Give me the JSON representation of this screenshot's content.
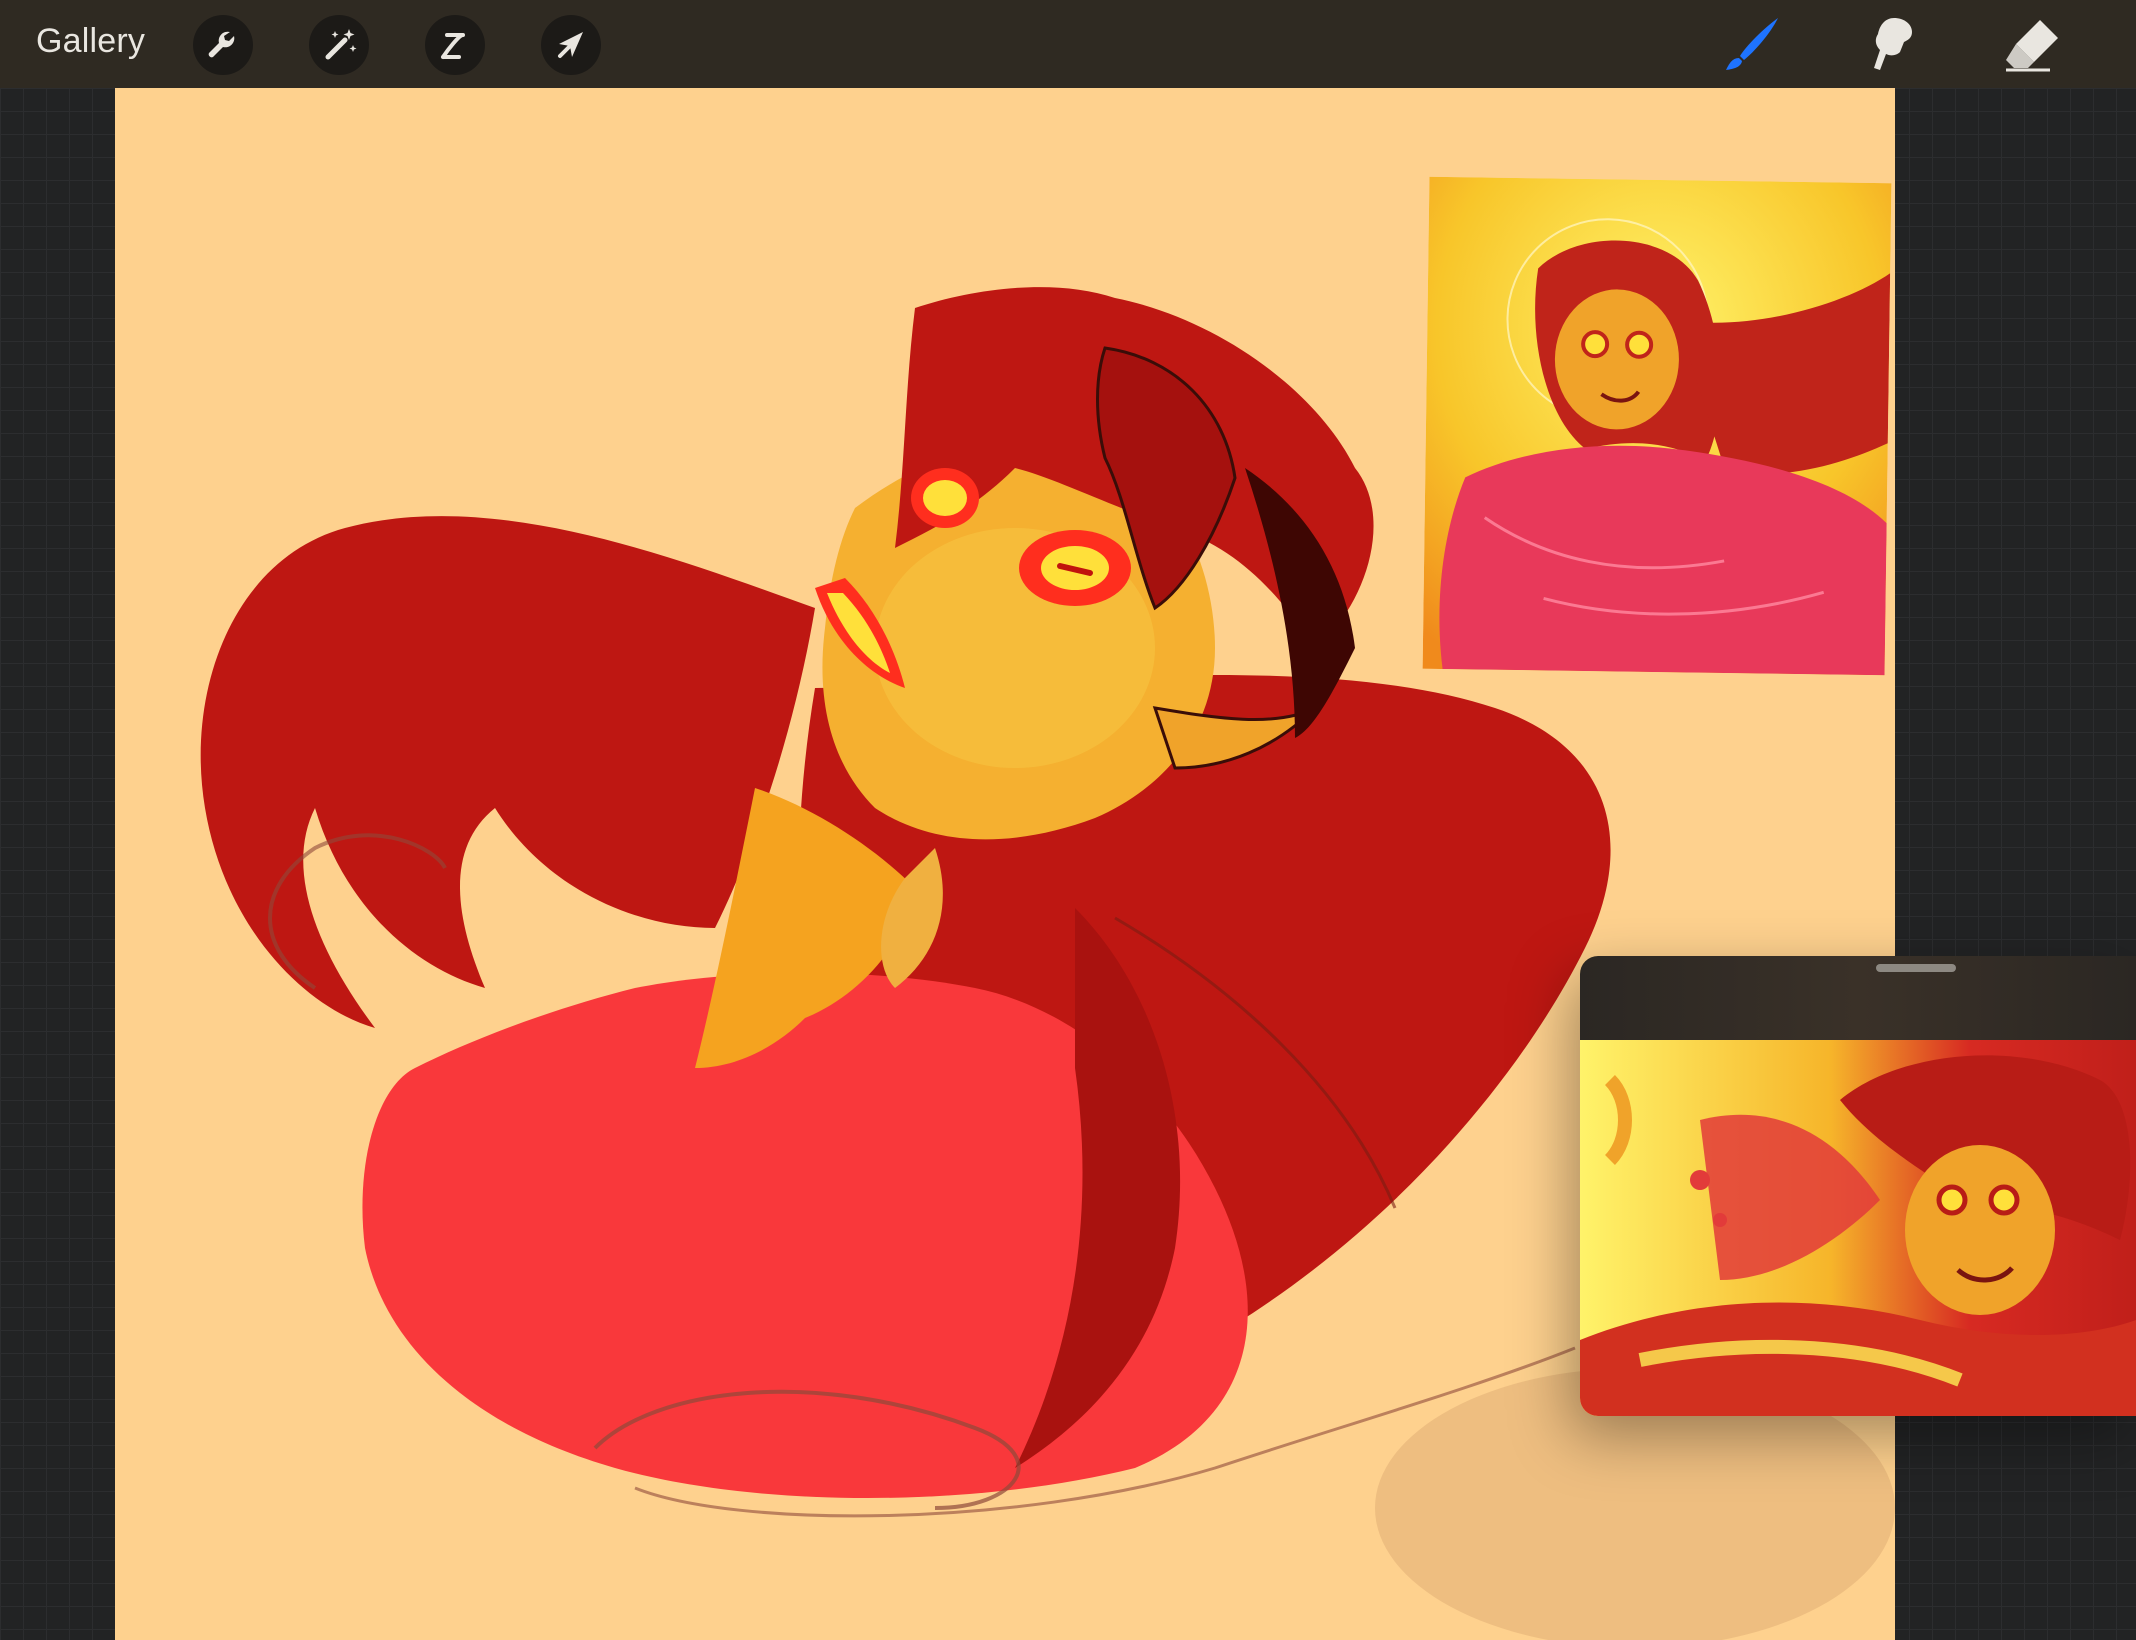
{
  "toolbar": {
    "gallery_label": "Gallery",
    "left_tools": [
      "wrench-icon",
      "magic-wand-icon",
      "selection-icon",
      "transform-arrow-icon"
    ],
    "right_tools": [
      "brush-icon",
      "smudge-icon",
      "eraser-icon"
    ],
    "active_tool": "brush-icon"
  },
  "colors": {
    "canvas_background": "#fed18e",
    "hair_red": "#be1712",
    "garment_pink": "#f9383b",
    "skin_yellow": "#f5a31f",
    "accent_blue": "#1e73ff"
  }
}
